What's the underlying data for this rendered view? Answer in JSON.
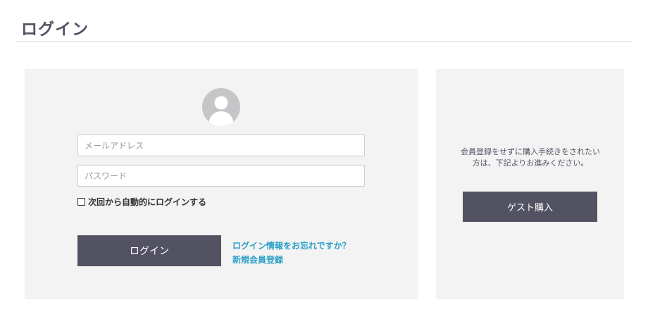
{
  "page": {
    "title": "ログイン"
  },
  "login": {
    "email_placeholder": "メールアドレス",
    "password_placeholder": "パスワード",
    "remember_label": "次回から自動的にログインする",
    "login_button": "ログイン",
    "forgot_link": "ログイン情報をお忘れですか？",
    "register_link": "新規会員登録"
  },
  "guest": {
    "description": "会員登録をせずに購入手続きをされたい方は、下記よりお進みください。",
    "button": "ゲスト購入"
  },
  "icons": {
    "avatar": "user-avatar-icon",
    "checkbox": "checkbox-unchecked-icon"
  },
  "colors": {
    "button": "#525263",
    "panel": "#f3f3f3",
    "link": "#2a9fc6",
    "avatar": "#c6c6c9"
  }
}
